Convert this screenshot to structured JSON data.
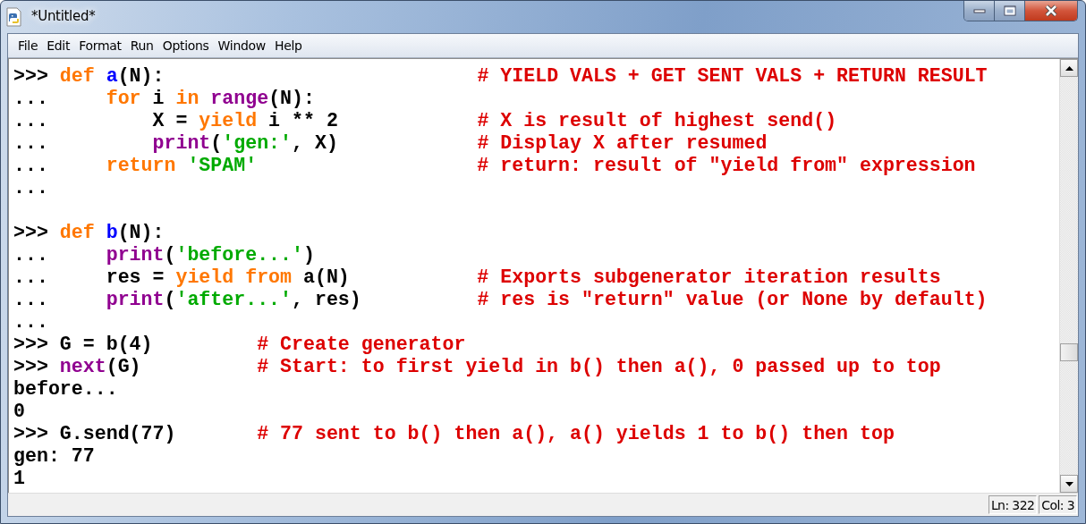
{
  "window": {
    "title": "*Untitled*"
  },
  "menu": [
    {
      "label": "File"
    },
    {
      "label": "Edit"
    },
    {
      "label": "Format"
    },
    {
      "label": "Run"
    },
    {
      "label": "Options"
    },
    {
      "label": "Window"
    },
    {
      "label": "Help"
    }
  ],
  "editor": {
    "lines": [
      [
        {
          "kind": "prompt",
          "text": ">>> "
        },
        {
          "kind": "keyword",
          "text": "def"
        },
        {
          "kind": "definition",
          "text": " a"
        },
        {
          "kind": "plain",
          "text": "(N):"
        },
        {
          "kind": "comment",
          "text": "                           # YIELD VALS + GET SENT VALS + RETURN RESULT"
        }
      ],
      [
        {
          "kind": "prompt",
          "text": "...     "
        },
        {
          "kind": "keyword",
          "text": "for"
        },
        {
          "kind": "plain",
          "text": " i "
        },
        {
          "kind": "keyword",
          "text": "in"
        },
        {
          "kind": "builtin",
          "text": " range"
        },
        {
          "kind": "plain",
          "text": "(N):"
        }
      ],
      [
        {
          "kind": "prompt",
          "text": "...         "
        },
        {
          "kind": "plain",
          "text": "X = "
        },
        {
          "kind": "keyword",
          "text": "yield"
        },
        {
          "kind": "plain",
          "text": " i ** 2"
        },
        {
          "kind": "comment",
          "text": "            # X is result of highest send()"
        }
      ],
      [
        {
          "kind": "prompt",
          "text": "...         "
        },
        {
          "kind": "builtin",
          "text": "print"
        },
        {
          "kind": "plain",
          "text": "("
        },
        {
          "kind": "string",
          "text": "'gen:'"
        },
        {
          "kind": "plain",
          "text": ", X)"
        },
        {
          "kind": "comment",
          "text": "            # Display X after resumed"
        }
      ],
      [
        {
          "kind": "prompt",
          "text": "...     "
        },
        {
          "kind": "keyword",
          "text": "return"
        },
        {
          "kind": "string",
          "text": " 'SPAM'"
        },
        {
          "kind": "comment",
          "text": "                   # return: result of \"yield from\" expression"
        }
      ],
      [
        {
          "kind": "prompt",
          "text": "..."
        }
      ],
      [
        {
          "kind": "blank"
        }
      ],
      [
        {
          "kind": "prompt",
          "text": ">>> "
        },
        {
          "kind": "keyword",
          "text": "def"
        },
        {
          "kind": "definition",
          "text": " b"
        },
        {
          "kind": "plain",
          "text": "(N):"
        }
      ],
      [
        {
          "kind": "prompt",
          "text": "...     "
        },
        {
          "kind": "builtin",
          "text": "print"
        },
        {
          "kind": "plain",
          "text": "("
        },
        {
          "kind": "string",
          "text": "'before...'"
        },
        {
          "kind": "plain",
          "text": ")"
        }
      ],
      [
        {
          "kind": "prompt",
          "text": "...     "
        },
        {
          "kind": "plain",
          "text": "res = "
        },
        {
          "kind": "keyword",
          "text": "yield"
        },
        {
          "kind": "keyword",
          "text": " from"
        },
        {
          "kind": "plain",
          "text": " a(N)"
        },
        {
          "kind": "comment",
          "text": "           # Exports subgenerator iteration results"
        }
      ],
      [
        {
          "kind": "prompt",
          "text": "...     "
        },
        {
          "kind": "builtin",
          "text": "print"
        },
        {
          "kind": "plain",
          "text": "("
        },
        {
          "kind": "string",
          "text": "'after...'"
        },
        {
          "kind": "plain",
          "text": ", res)"
        },
        {
          "kind": "comment",
          "text": "          # res is \"return\" value (or None by default)"
        }
      ],
      [
        {
          "kind": "prompt",
          "text": "..."
        }
      ],
      [
        {
          "kind": "prompt",
          "text": ">>> "
        },
        {
          "kind": "plain",
          "text": "G = b(4)"
        },
        {
          "kind": "comment",
          "text": "         # Create generator"
        }
      ],
      [
        {
          "kind": "prompt",
          "text": ">>> "
        },
        {
          "kind": "builtin",
          "text": "next"
        },
        {
          "kind": "plain",
          "text": "(G)"
        },
        {
          "kind": "comment",
          "text": "          # Start: to first yield in b() then a(), 0 passed up to top"
        }
      ],
      [
        {
          "kind": "output",
          "text": "before..."
        }
      ],
      [
        {
          "kind": "output",
          "text": "0"
        }
      ],
      [
        {
          "kind": "prompt",
          "text": ">>> "
        },
        {
          "kind": "plain",
          "text": "G.send(77)"
        },
        {
          "kind": "comment",
          "text": "       # 77 sent to b() then a(), a() yields 1 to b() then top"
        }
      ],
      [
        {
          "kind": "output",
          "text": "gen: 77"
        }
      ],
      [
        {
          "kind": "output",
          "text": "1"
        }
      ]
    ]
  },
  "status_bar": {
    "line": "Ln: 322",
    "column": "Col: 3"
  }
}
